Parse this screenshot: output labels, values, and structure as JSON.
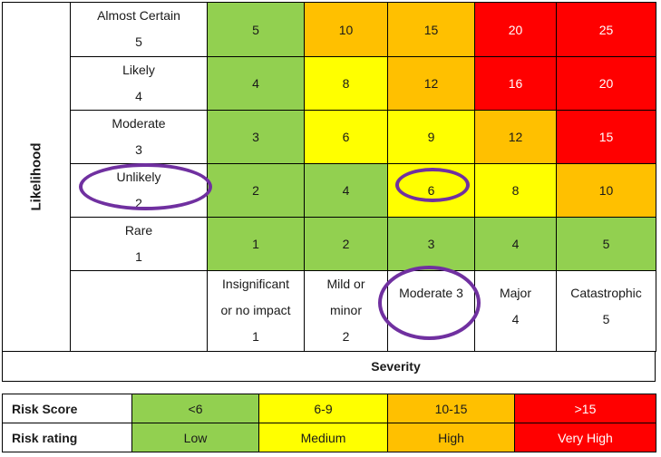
{
  "colors": {
    "low": "#92d050",
    "medium": "#ffff00",
    "high": "#ffc000",
    "very_high": "#ff0000",
    "highlight_ring": "#7030a0"
  },
  "matrix": {
    "likelihood_axis_label": "Likelihood",
    "severity_axis_label": "Severity",
    "likelihood_rows": [
      {
        "name": "Almost Certain",
        "value": "5",
        "scores": [
          "5",
          "10",
          "15",
          "20",
          "25"
        ],
        "levels": [
          "low",
          "high",
          "high",
          "very_high",
          "very_high"
        ]
      },
      {
        "name": "Likely",
        "value": "4",
        "scores": [
          "4",
          "8",
          "12",
          "16",
          "20"
        ],
        "levels": [
          "low",
          "medium",
          "high",
          "very_high",
          "very_high"
        ]
      },
      {
        "name": "Moderate",
        "value": "3",
        "scores": [
          "3",
          "6",
          "9",
          "12",
          "15"
        ],
        "levels": [
          "low",
          "medium",
          "medium",
          "high",
          "very_high"
        ]
      },
      {
        "name": "Unlikely",
        "value": "2",
        "scores": [
          "2",
          "4",
          "6",
          "8",
          "10"
        ],
        "levels": [
          "low",
          "low",
          "medium",
          "medium",
          "high"
        ]
      },
      {
        "name": "Rare",
        "value": "1",
        "scores": [
          "1",
          "2",
          "3",
          "4",
          "5"
        ],
        "levels": [
          "low",
          "low",
          "low",
          "low",
          "low"
        ]
      }
    ],
    "severity_columns": [
      {
        "lines": [
          "Insignificant",
          "or no impact",
          "1"
        ]
      },
      {
        "lines": [
          "Mild or",
          "minor",
          "2"
        ]
      },
      {
        "lines": [
          "Moderate 3"
        ]
      },
      {
        "lines": [
          "Major",
          "4"
        ]
      },
      {
        "lines": [
          "Catastrophic",
          "5"
        ]
      }
    ],
    "highlighted": {
      "likelihood": "Unlikely 2",
      "severity": "Moderate 3",
      "score": "6"
    }
  },
  "legend": {
    "score_label": "Risk Score",
    "rating_label": "Risk rating",
    "bands": [
      {
        "score": "<6",
        "rating": "Low",
        "level": "low"
      },
      {
        "score": "6-9",
        "rating": "Medium",
        "level": "medium"
      },
      {
        "score": "10-15",
        "rating": "High",
        "level": "high"
      },
      {
        "score": ">15",
        "rating": "Very High",
        "level": "very_high"
      }
    ]
  }
}
